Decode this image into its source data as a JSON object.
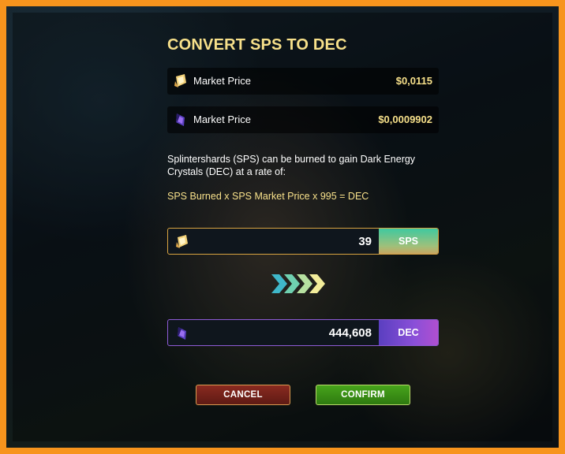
{
  "dialog": {
    "title": "CONVERT SPS TO DEC",
    "prices": [
      {
        "label": "Market Price",
        "value": "$0,0115",
        "icon": "sps-token-icon"
      },
      {
        "label": "Market Price",
        "value": "$0,0009902",
        "icon": "dec-crystal-icon"
      }
    ],
    "description": "Splintershards (SPS) can be burned to gain Dark Energy Crystals (DEC) at a rate of:",
    "formula": "SPS Burned x SPS Market Price x 995 = DEC",
    "from": {
      "amount": "39",
      "unit": "SPS",
      "icon": "sps-token-icon"
    },
    "to": {
      "amount": "444,608",
      "unit": "DEC",
      "icon": "dec-crystal-icon"
    },
    "arrows_icon": "chevron-right-arrows-icon",
    "buttons": {
      "cancel": "CANCEL",
      "confirm": "CONFIRM"
    }
  },
  "colors": {
    "frame": "#f7941d",
    "accent_text": "#f7e08a",
    "sps_unit": "#3fc9a0",
    "dec_unit": "#8a4fd8",
    "cancel": "#6e2018",
    "confirm": "#3c8f16"
  }
}
